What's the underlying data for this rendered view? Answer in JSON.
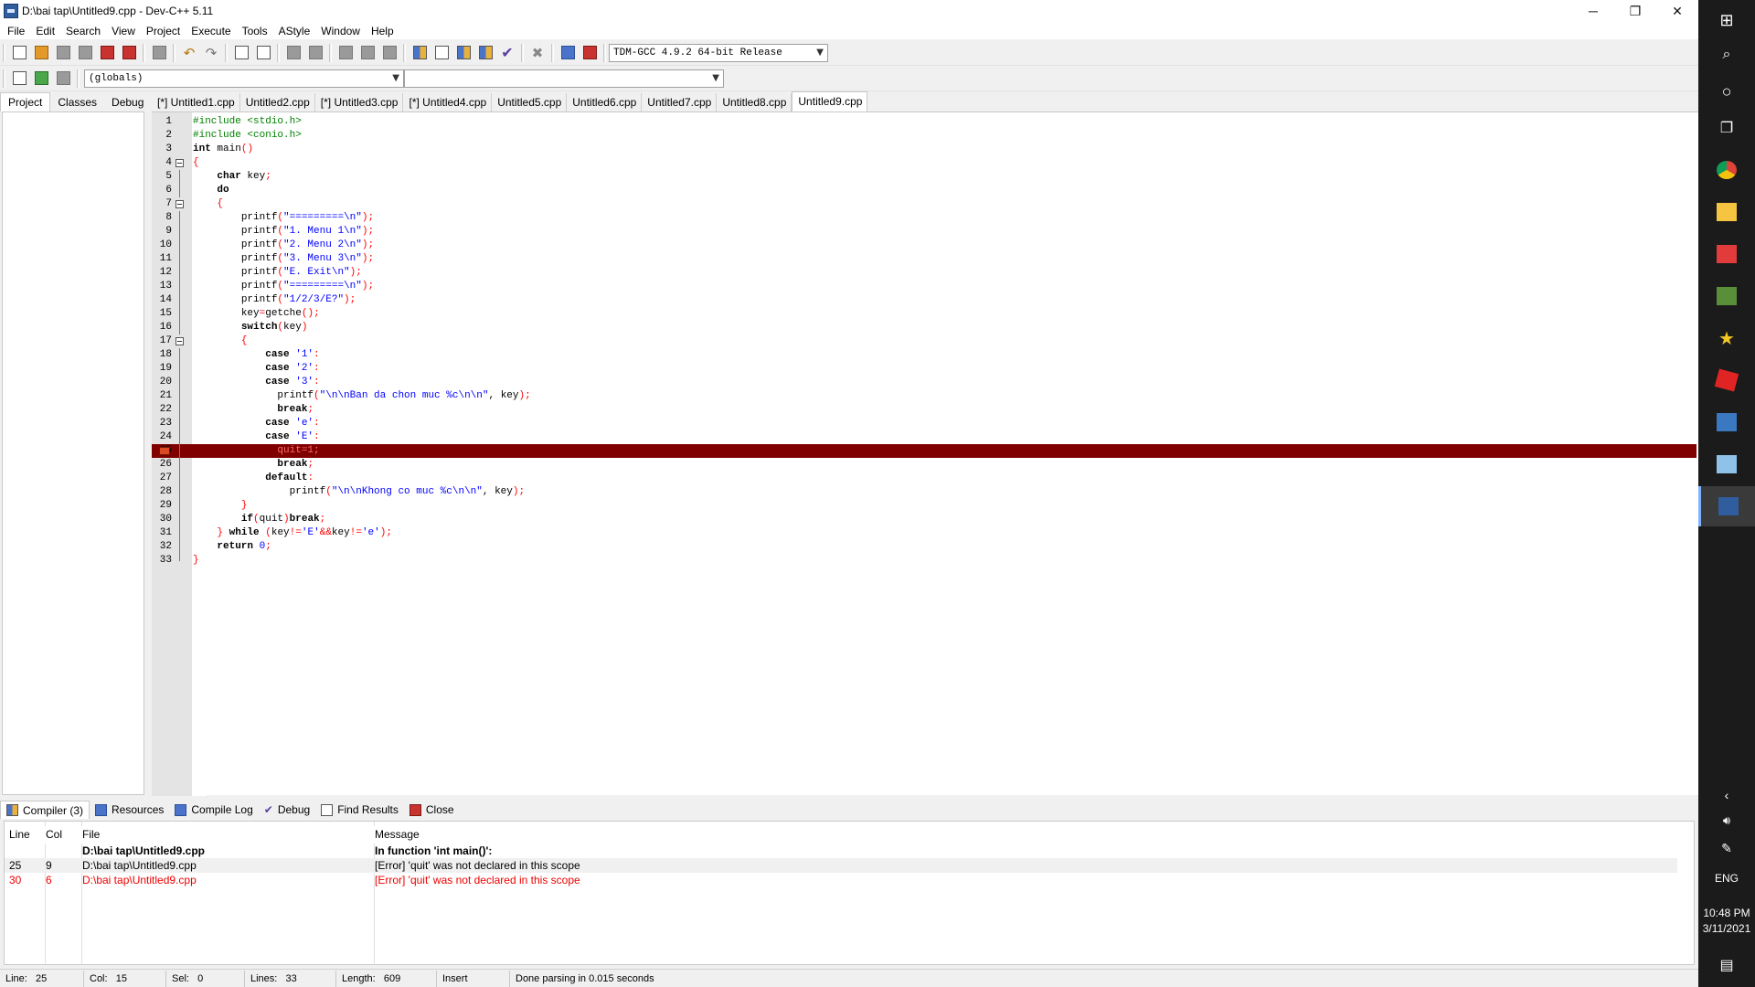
{
  "window": {
    "title": "D:\\bai tap\\Untitled9.cpp - Dev-C++ 5.11",
    "minimize": "─",
    "maximize": "❐",
    "close": "✕"
  },
  "menu": [
    "File",
    "Edit",
    "Search",
    "View",
    "Project",
    "Execute",
    "Tools",
    "AStyle",
    "Window",
    "Help"
  ],
  "toolbar": {
    "compiler_select": "TDM-GCC 4.9.2 64-bit Release",
    "scope_select": "(globals)",
    "member_select": ""
  },
  "left_tabs": [
    "Project",
    "Classes",
    "Debug"
  ],
  "editor_tabs": [
    "[*] Untitled1.cpp",
    "Untitled2.cpp",
    "[*] Untitled3.cpp",
    "[*] Untitled4.cpp",
    "Untitled5.cpp",
    "Untitled6.cpp",
    "Untitled7.cpp",
    "Untitled8.cpp",
    "Untitled9.cpp"
  ],
  "active_editor_tab": "Untitled9.cpp",
  "code_lines": [
    {
      "n": "1",
      "t": "#include <stdio.h>"
    },
    {
      "n": "2",
      "t": "#include <conio.h>"
    },
    {
      "n": "3",
      "t": "int main()"
    },
    {
      "n": "4",
      "t": "{"
    },
    {
      "n": "5",
      "t": "    char key;"
    },
    {
      "n": "6",
      "t": "    do"
    },
    {
      "n": "7",
      "t": "    {"
    },
    {
      "n": "8",
      "t": "        printf(\"=========\\n\");"
    },
    {
      "n": "9",
      "t": "        printf(\"1. Menu 1\\n\");"
    },
    {
      "n": "10",
      "t": "        printf(\"2. Menu 2\\n\");"
    },
    {
      "n": "11",
      "t": "        printf(\"3. Menu 3\\n\");"
    },
    {
      "n": "12",
      "t": "        printf(\"E. Exit\\n\");"
    },
    {
      "n": "13",
      "t": "        printf(\"=========\\n\");"
    },
    {
      "n": "14",
      "t": "        printf(\"1/2/3/E?\");"
    },
    {
      "n": "15",
      "t": "        key=getche();"
    },
    {
      "n": "16",
      "t": "        switch(key)"
    },
    {
      "n": "17",
      "t": "        {"
    },
    {
      "n": "18",
      "t": "            case '1':"
    },
    {
      "n": "19",
      "t": "            case '2':"
    },
    {
      "n": "20",
      "t": "            case '3':"
    },
    {
      "n": "21",
      "t": "              printf(\"\\n\\nBan da chon muc %c\\n\\n\", key);"
    },
    {
      "n": "22",
      "t": "              break;"
    },
    {
      "n": "23",
      "t": "            case 'e':"
    },
    {
      "n": "24",
      "t": "            case 'E':"
    },
    {
      "n": "25",
      "t": "              quit=1;"
    },
    {
      "n": "26",
      "t": "              break;"
    },
    {
      "n": "27",
      "t": "            default:"
    },
    {
      "n": "28",
      "t": "                printf(\"\\n\\nKhong co muc %c\\n\\n\", key);"
    },
    {
      "n": "29",
      "t": "        }"
    },
    {
      "n": "30",
      "t": "        if(quit)break;"
    },
    {
      "n": "31",
      "t": "    } while (key!='E'&&key!='e');"
    },
    {
      "n": "32",
      "t": "    return 0;"
    },
    {
      "n": "33",
      "t": "}"
    }
  ],
  "error_line": "25",
  "bottom_tabs": [
    "Compiler (3)",
    "Resources",
    "Compile Log",
    "Debug",
    "Find Results",
    "Close"
  ],
  "messages": {
    "headers": [
      "Line",
      "Col",
      "File",
      "Message"
    ],
    "rows": [
      {
        "line": "",
        "col": "",
        "file": "D:\\bai tap\\Untitled9.cpp",
        "msg": "In function 'int main()':",
        "style": "bold"
      },
      {
        "line": "25",
        "col": "9",
        "file": "D:\\bai tap\\Untitled9.cpp",
        "msg": "[Error] 'quit' was not declared in this scope",
        "style": "alt"
      },
      {
        "line": "30",
        "col": "6",
        "file": "D:\\bai tap\\Untitled9.cpp",
        "msg": "[Error] 'quit' was not declared in this scope",
        "style": "red"
      }
    ]
  },
  "status": {
    "line_label": "Line:",
    "line": "25",
    "col_label": "Col:",
    "col": "15",
    "sel_label": "Sel:",
    "sel": "0",
    "lines_label": "Lines:",
    "lines": "33",
    "length_label": "Length:",
    "length": "609",
    "mode": "Insert",
    "message": "Done parsing in 0.015 seconds"
  },
  "taskbar": {
    "language": "ENG",
    "time": "10:48 PM",
    "date": "3/11/2021"
  }
}
